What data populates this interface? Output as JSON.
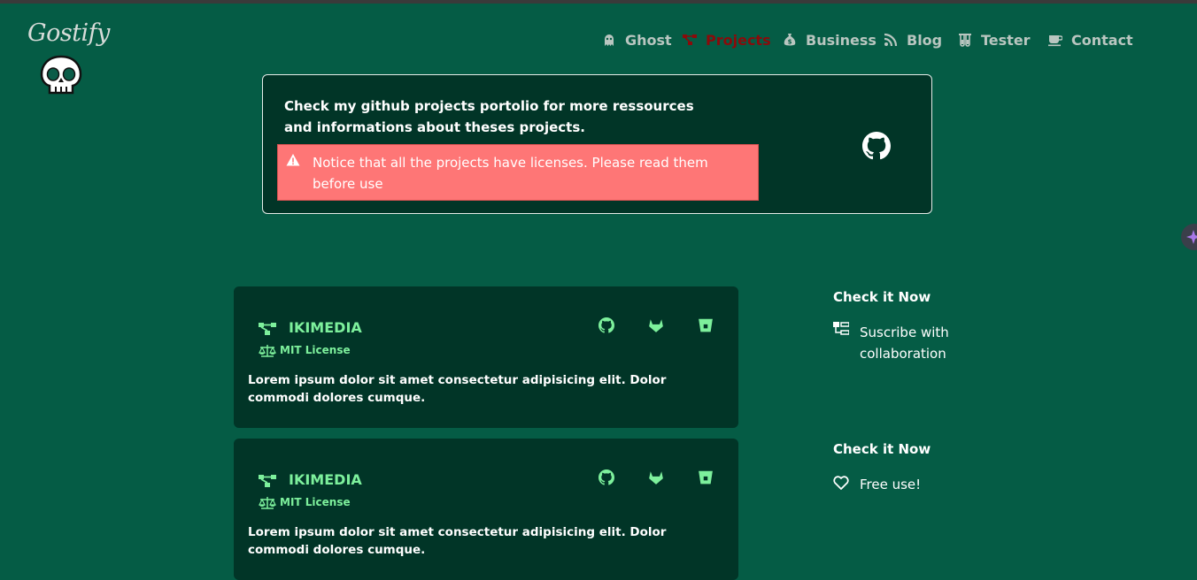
{
  "brand": {
    "name": "Gostify"
  },
  "nav": [
    {
      "label": "Ghost",
      "icon": "ghost-icon",
      "active": false
    },
    {
      "label": "Projects",
      "icon": "project-diagram-icon",
      "active": true
    },
    {
      "label": "Business",
      "icon": "money-bag-icon",
      "active": false
    },
    {
      "label": "Blog",
      "icon": "rss-icon",
      "active": false
    },
    {
      "label": "Tester",
      "icon": "flask-icon",
      "active": false
    },
    {
      "label": "Contact",
      "icon": "coffee-cup-icon",
      "active": false
    }
  ],
  "info": {
    "text": "Check my github projects portolio for more ressources and informations about theses projects.",
    "notice": "Notice that all the projects have licenses. Please read them before use",
    "icon": "github-icon"
  },
  "projects": [
    {
      "title": "IKIMEDIA",
      "license": "MIT License",
      "description": "Lorem ipsum dolor sit amet consectetur adipisicing elit. Dolor commodi dolores cumque.",
      "links": [
        "github-icon",
        "gitlab-icon",
        "bitbucket-icon"
      ]
    },
    {
      "title": "IKIMEDIA",
      "license": "MIT License",
      "description": "Lorem ipsum dolor sit amet consectetur adipisicing elit. Dolor commodi dolores cumque.",
      "links": [
        "github-icon",
        "gitlab-icon",
        "bitbucket-icon"
      ]
    }
  ],
  "sidebar": [
    {
      "title": "Check it Now",
      "text": "Suscribe with collaboration",
      "icon": "sitemap-icon"
    },
    {
      "title": "Check it Now",
      "text": "Free use!",
      "icon": "heart-icon"
    }
  ],
  "colors": {
    "background": "#055c45",
    "panel": "#013527",
    "accent_green": "#7df09c",
    "active_nav": "#8a0b0b",
    "alert": "#fe7676"
  }
}
